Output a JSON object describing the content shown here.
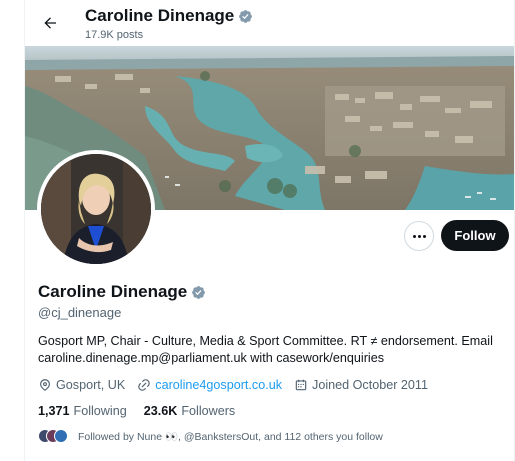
{
  "header": {
    "name": "Caroline Dinenage",
    "posts_count": "17.9K posts"
  },
  "profile": {
    "display_name": "Caroline Dinenage",
    "handle": "@cj_dinenage",
    "bio_line1": "Gosport MP, Chair - Culture, Media & Sport Committee. RT ≠ endorsement. Email",
    "bio_line2": "caroline.dinenage.mp@parliament.uk with casework/enquiries",
    "location": "Gosport, UK",
    "website": "caroline4gosport.co.uk",
    "joined": "Joined October 2011",
    "following_count": "1,371",
    "following_label": "Following",
    "followers_count": "23.6K",
    "followers_label": "Followers",
    "followed_by_text": "Followed by Nune 👀, @BankstersOut, and 112 others you follow"
  },
  "actions": {
    "follow_label": "Follow"
  },
  "icons": {
    "back": "arrow-left-icon",
    "verified": "verified-badge-icon",
    "more": "more-horizontal-icon",
    "location": "location-pin-icon",
    "link": "link-icon",
    "calendar": "calendar-icon"
  },
  "colors": {
    "accent": "#1d9bf0",
    "text_primary": "#0f1419",
    "text_secondary": "#536471",
    "follow_button_bg": "#0f1419",
    "verified_badge": "#829aab"
  }
}
